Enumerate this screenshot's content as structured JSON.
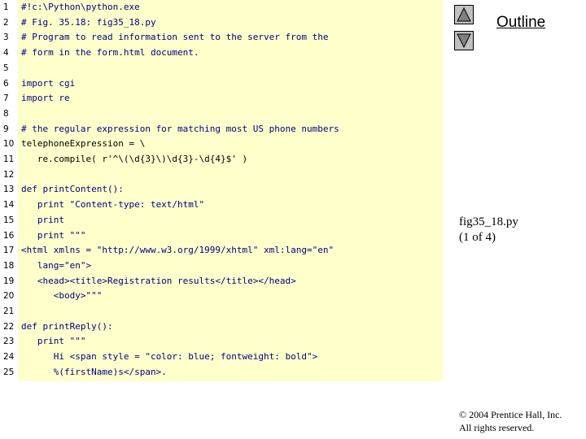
{
  "code": {
    "lines": [
      {
        "num": "1",
        "text": "#!c:\\Python\\python.exe",
        "kind": "comment"
      },
      {
        "num": "2",
        "text": "# Fig. 35.18: fig35_18.py",
        "kind": "comment"
      },
      {
        "num": "3",
        "text": "# Program to read information sent to the server from the",
        "kind": "comment"
      },
      {
        "num": "4",
        "text": "# form in the form.html document.",
        "kind": "comment"
      },
      {
        "num": "5",
        "text": "",
        "kind": "plain"
      },
      {
        "num": "6",
        "text": "import cgi",
        "kind": "keyword"
      },
      {
        "num": "7",
        "text": "import re",
        "kind": "keyword"
      },
      {
        "num": "8",
        "text": "",
        "kind": "plain"
      },
      {
        "num": "9",
        "text": "# the regular expression for matching most US phone numbers",
        "kind": "comment"
      },
      {
        "num": "10",
        "text": "telephoneExpression = \\",
        "kind": "plain"
      },
      {
        "num": "11",
        "text": "   re.compile( r'^\\(\\d{3}\\)\\d{3}-\\d{4}$' )",
        "kind": "plain"
      },
      {
        "num": "12",
        "text": "",
        "kind": "plain"
      },
      {
        "num": "13",
        "text": "def printContent():",
        "kind": "keyword"
      },
      {
        "num": "14",
        "text": "   print \"Content-type: text/html\"",
        "kind": "string"
      },
      {
        "num": "15",
        "text": "   print",
        "kind": "keyword"
      },
      {
        "num": "16",
        "text": "   print \"\"\"",
        "kind": "string"
      },
      {
        "num": "17",
        "text": "<html xmlns = \"http://www.w3.org/1999/xhtml\" xml:lang=\"en\"",
        "kind": "string"
      },
      {
        "num": "18",
        "text": "   lang=\"en\">",
        "kind": "string"
      },
      {
        "num": "19",
        "text": "   <head><title>Registration results</title></head>",
        "kind": "string"
      },
      {
        "num": "20",
        "text": "      <body>\"\"\"",
        "kind": "string"
      },
      {
        "num": "21",
        "text": "",
        "kind": "plain"
      },
      {
        "num": "22",
        "text": "def printReply():",
        "kind": "keyword"
      },
      {
        "num": "23",
        "text": "   print \"\"\"",
        "kind": "string"
      },
      {
        "num": "24",
        "text": "      Hi <span style = \"color: blue; fontweight: bold\">",
        "kind": "string"
      },
      {
        "num": "25",
        "text": "      %(firstName)s</span>.",
        "kind": "string"
      }
    ]
  },
  "sidebar": {
    "outline_label": "Outline",
    "caption_line1": "fig35_18.py",
    "caption_line2": "(1 of 4)",
    "copyright_line1": "© 2004 Prentice Hall, Inc.",
    "copyright_line2": "All rights reserved.",
    "nav_up_icon": "triangle-up-icon",
    "nav_down_icon": "triangle-down-icon"
  },
  "colors": {
    "code_background": "#ffffcc",
    "code_text": "#000080",
    "nav_button": "#c0c0c0"
  }
}
